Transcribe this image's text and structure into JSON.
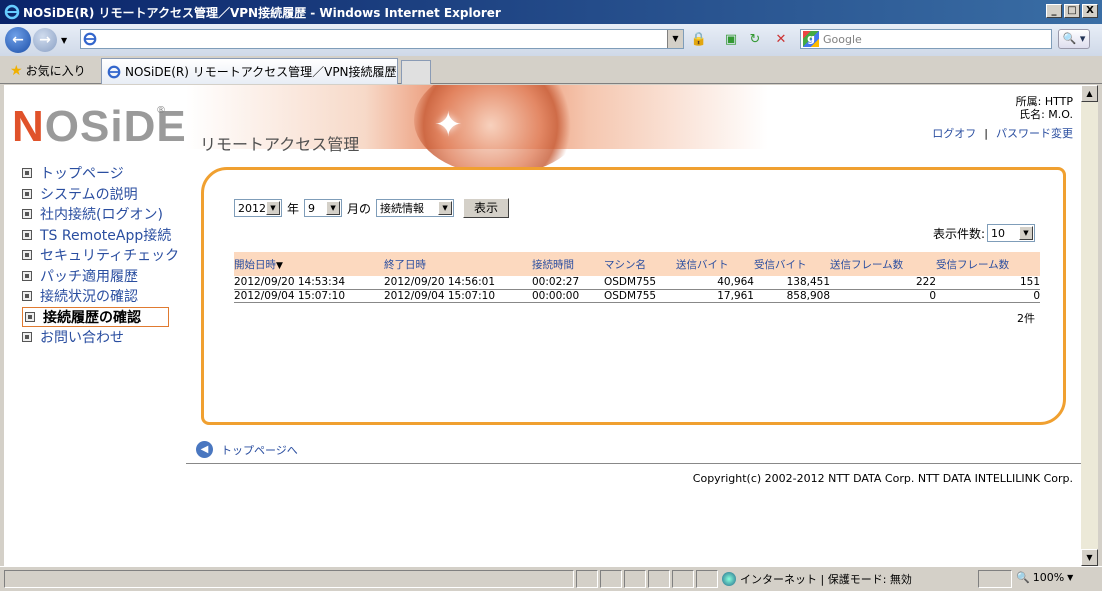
{
  "window": {
    "title": "NOSiDE(R) リモートアクセス管理／VPN接続履歴 - Windows Internet Explorer",
    "min": "_",
    "max": "□",
    "close": "X"
  },
  "toolbar": {
    "search_placeholder": "Google"
  },
  "tabs": {
    "favorites_label": "お気に入り",
    "active_tab": "NOSiDE(R) リモートアクセス管理／VPN接続履歴"
  },
  "header": {
    "logo_n": "N",
    "logo_rest": "OSiDE",
    "subtitle": "リモートアクセス管理",
    "affiliation": "所属: HTTP",
    "name": "氏名: M.O.",
    "logoff": "ログオフ",
    "separator": "|",
    "password_change": "パスワード変更"
  },
  "sidebar": {
    "items": [
      {
        "label": "トップページ"
      },
      {
        "label": "システムの説明"
      },
      {
        "label": "社内接続(ログオン)"
      },
      {
        "label": "TS RemoteApp接続"
      },
      {
        "label": "セキュリティチェック"
      },
      {
        "label": "パッチ適用履歴"
      },
      {
        "label": "接続状況の確認"
      },
      {
        "label": "接続履歴の確認"
      },
      {
        "label": "お問い合わせ"
      }
    ]
  },
  "filter": {
    "year_value": "2012",
    "year_suffix": "年",
    "month_value": "9",
    "month_suffix": "月の",
    "type_value": "接続情報",
    "show_button": "表示",
    "per_page_label": "表示件数:",
    "per_page_value": "10"
  },
  "table": {
    "headers": [
      "開始日時",
      "終了日時",
      "接続時間",
      "マシン名",
      "送信バイト",
      "受信バイト",
      "送信フレーム数",
      "受信フレーム数"
    ],
    "rows": [
      [
        "2012/09/20 14:53:34",
        "2012/09/20 14:56:01",
        "00:02:27",
        "OSDM755",
        "40,964",
        "138,451",
        "222",
        "151"
      ],
      [
        "2012/09/04 15:07:10",
        "2012/09/04 15:07:10",
        "00:00:00",
        "OSDM755",
        "17,961",
        "858,908",
        "0",
        "0"
      ]
    ],
    "count": "2件",
    "sort_indicator": "▼"
  },
  "footer": {
    "back_to_top": "トップページへ",
    "copyright": "Copyright(c) 2002-2012 NTT DATA Corp. NTT DATA INTELLILINK Corp."
  },
  "statusbar": {
    "zone": "インターネット | 保護モード: 無効",
    "zoom": "100%"
  },
  "colors": {
    "accent_orange": "#f0a030",
    "link_blue": "#2a4ea0",
    "table_header_bg": "#fcd9bf",
    "logo_red": "#e0522a"
  }
}
